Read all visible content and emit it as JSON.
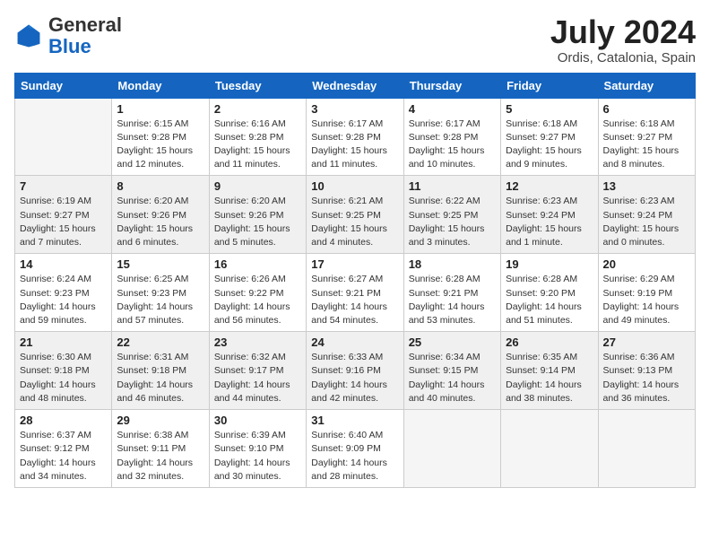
{
  "header": {
    "logo_general": "General",
    "logo_blue": "Blue",
    "month_title": "July 2024",
    "location": "Ordis, Catalonia, Spain"
  },
  "weekdays": [
    "Sunday",
    "Monday",
    "Tuesday",
    "Wednesday",
    "Thursday",
    "Friday",
    "Saturday"
  ],
  "weeks": [
    [
      {
        "day": "",
        "empty": true
      },
      {
        "day": "1",
        "rise": "6:15 AM",
        "set": "9:28 PM",
        "daylight": "15 hours and 12 minutes."
      },
      {
        "day": "2",
        "rise": "6:16 AM",
        "set": "9:28 PM",
        "daylight": "15 hours and 11 minutes."
      },
      {
        "day": "3",
        "rise": "6:17 AM",
        "set": "9:28 PM",
        "daylight": "15 hours and 11 minutes."
      },
      {
        "day": "4",
        "rise": "6:17 AM",
        "set": "9:28 PM",
        "daylight": "15 hours and 10 minutes."
      },
      {
        "day": "5",
        "rise": "6:18 AM",
        "set": "9:27 PM",
        "daylight": "15 hours and 9 minutes."
      },
      {
        "day": "6",
        "rise": "6:18 AM",
        "set": "9:27 PM",
        "daylight": "15 hours and 8 minutes."
      }
    ],
    [
      {
        "day": "7",
        "rise": "6:19 AM",
        "set": "9:27 PM",
        "daylight": "15 hours and 7 minutes."
      },
      {
        "day": "8",
        "rise": "6:20 AM",
        "set": "9:26 PM",
        "daylight": "15 hours and 6 minutes."
      },
      {
        "day": "9",
        "rise": "6:20 AM",
        "set": "9:26 PM",
        "daylight": "15 hours and 5 minutes."
      },
      {
        "day": "10",
        "rise": "6:21 AM",
        "set": "9:25 PM",
        "daylight": "15 hours and 4 minutes."
      },
      {
        "day": "11",
        "rise": "6:22 AM",
        "set": "9:25 PM",
        "daylight": "15 hours and 3 minutes."
      },
      {
        "day": "12",
        "rise": "6:23 AM",
        "set": "9:24 PM",
        "daylight": "15 hours and 1 minute."
      },
      {
        "day": "13",
        "rise": "6:23 AM",
        "set": "9:24 PM",
        "daylight": "15 hours and 0 minutes."
      }
    ],
    [
      {
        "day": "14",
        "rise": "6:24 AM",
        "set": "9:23 PM",
        "daylight": "14 hours and 59 minutes."
      },
      {
        "day": "15",
        "rise": "6:25 AM",
        "set": "9:23 PM",
        "daylight": "14 hours and 57 minutes."
      },
      {
        "day": "16",
        "rise": "6:26 AM",
        "set": "9:22 PM",
        "daylight": "14 hours and 56 minutes."
      },
      {
        "day": "17",
        "rise": "6:27 AM",
        "set": "9:21 PM",
        "daylight": "14 hours and 54 minutes."
      },
      {
        "day": "18",
        "rise": "6:28 AM",
        "set": "9:21 PM",
        "daylight": "14 hours and 53 minutes."
      },
      {
        "day": "19",
        "rise": "6:28 AM",
        "set": "9:20 PM",
        "daylight": "14 hours and 51 minutes."
      },
      {
        "day": "20",
        "rise": "6:29 AM",
        "set": "9:19 PM",
        "daylight": "14 hours and 49 minutes."
      }
    ],
    [
      {
        "day": "21",
        "rise": "6:30 AM",
        "set": "9:18 PM",
        "daylight": "14 hours and 48 minutes."
      },
      {
        "day": "22",
        "rise": "6:31 AM",
        "set": "9:18 PM",
        "daylight": "14 hours and 46 minutes."
      },
      {
        "day": "23",
        "rise": "6:32 AM",
        "set": "9:17 PM",
        "daylight": "14 hours and 44 minutes."
      },
      {
        "day": "24",
        "rise": "6:33 AM",
        "set": "9:16 PM",
        "daylight": "14 hours and 42 minutes."
      },
      {
        "day": "25",
        "rise": "6:34 AM",
        "set": "9:15 PM",
        "daylight": "14 hours and 40 minutes."
      },
      {
        "day": "26",
        "rise": "6:35 AM",
        "set": "9:14 PM",
        "daylight": "14 hours and 38 minutes."
      },
      {
        "day": "27",
        "rise": "6:36 AM",
        "set": "9:13 PM",
        "daylight": "14 hours and 36 minutes."
      }
    ],
    [
      {
        "day": "28",
        "rise": "6:37 AM",
        "set": "9:12 PM",
        "daylight": "14 hours and 34 minutes."
      },
      {
        "day": "29",
        "rise": "6:38 AM",
        "set": "9:11 PM",
        "daylight": "14 hours and 32 minutes."
      },
      {
        "day": "30",
        "rise": "6:39 AM",
        "set": "9:10 PM",
        "daylight": "14 hours and 30 minutes."
      },
      {
        "day": "31",
        "rise": "6:40 AM",
        "set": "9:09 PM",
        "daylight": "14 hours and 28 minutes."
      },
      {
        "day": "",
        "empty": true
      },
      {
        "day": "",
        "empty": true
      },
      {
        "day": "",
        "empty": true
      }
    ]
  ]
}
